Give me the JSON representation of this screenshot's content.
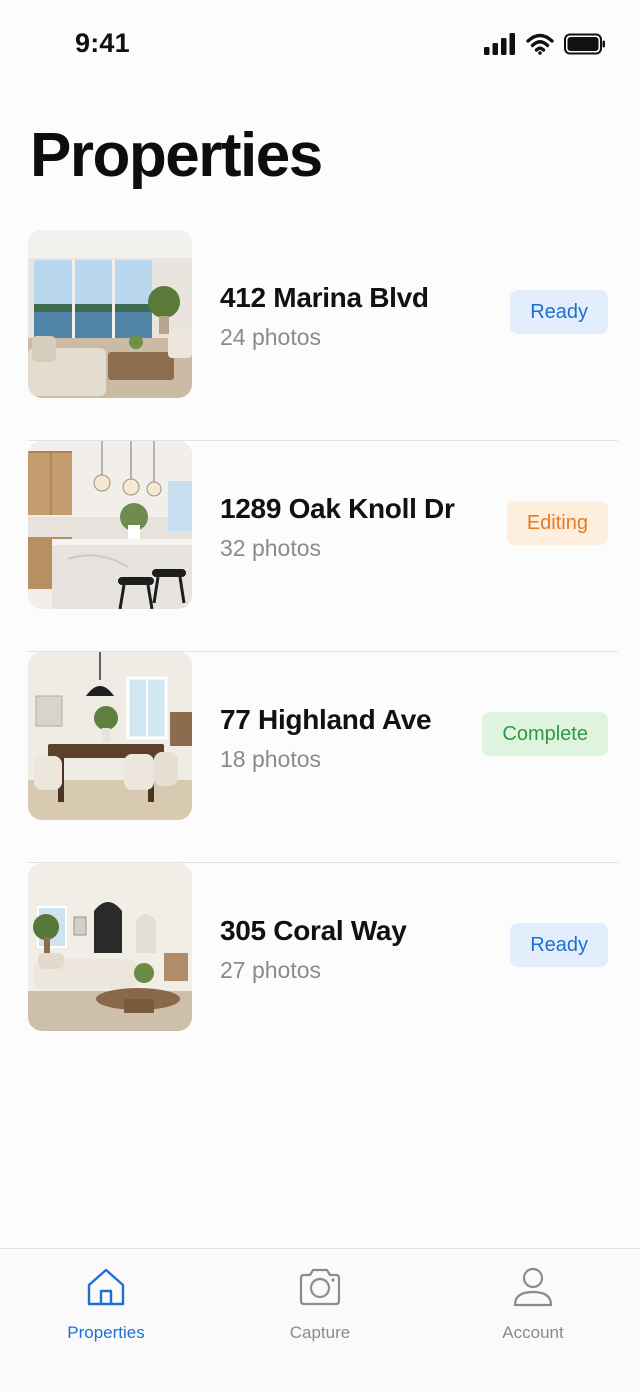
{
  "status_bar": {
    "time": "9:41"
  },
  "header": {
    "title": "Properties"
  },
  "properties": [
    {
      "address": "412 Marina Blvd",
      "photos": "24 photos",
      "status": "Ready",
      "status_color": "#1c6fd6"
    },
    {
      "address": "1289 Oak Knoll Dr",
      "photos": "32 photos",
      "status": "Editing",
      "status_color": "#e9791f"
    },
    {
      "address": "77 Highland Ave",
      "photos": "18 photos",
      "status": "Complete",
      "status_color": "#2e9a3d"
    },
    {
      "address": "305 Coral Way",
      "photos": "27 photos",
      "status": "Ready",
      "status_color": "#1c6fd6"
    }
  ],
  "tab_bar": {
    "tabs": [
      {
        "label": "Properties",
        "icon": "home-icon",
        "active": true
      },
      {
        "label": "Capture",
        "icon": "camera-icon",
        "active": false
      },
      {
        "label": "Account",
        "icon": "person-icon",
        "active": false
      }
    ]
  },
  "colors": {
    "accent": "#1c6fd6",
    "background": "#fcfcfc",
    "muted_text": "#8a8a8f"
  }
}
